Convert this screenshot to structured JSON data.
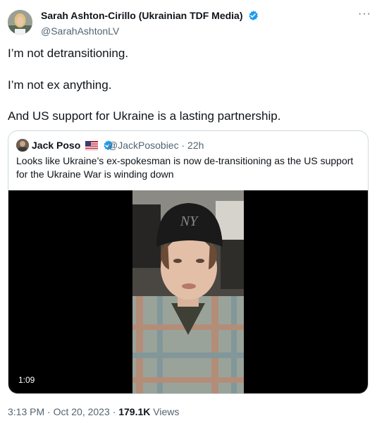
{
  "author": {
    "display_name": "Sarah Ashton-Cirillo (Ukrainian TDF Media)",
    "handle": "@SarahAshtonLV"
  },
  "more_label": "···",
  "tweet_lines": [
    "I’m not detransitioning.",
    "I’m not ex anything.",
    "And US support for Ukraine is a lasting partnership."
  ],
  "quoted": {
    "name": "Jack Poso",
    "handle": "@JackPosobiec",
    "separator": "·",
    "time": "22h",
    "text": "Looks like Ukraine’s ex-spokesman is now de-transitioning as the US support for the Ukraine War is winding down",
    "video_duration": "1:09"
  },
  "meta": {
    "time": "3:13 PM",
    "dot": "·",
    "date": "Oct 20, 2023",
    "views_count": "179.1K",
    "views_label": "Views"
  },
  "colors": {
    "verified_badge": "#1d9bf0",
    "secondary_text": "#536471",
    "border": "#cfd9de"
  }
}
